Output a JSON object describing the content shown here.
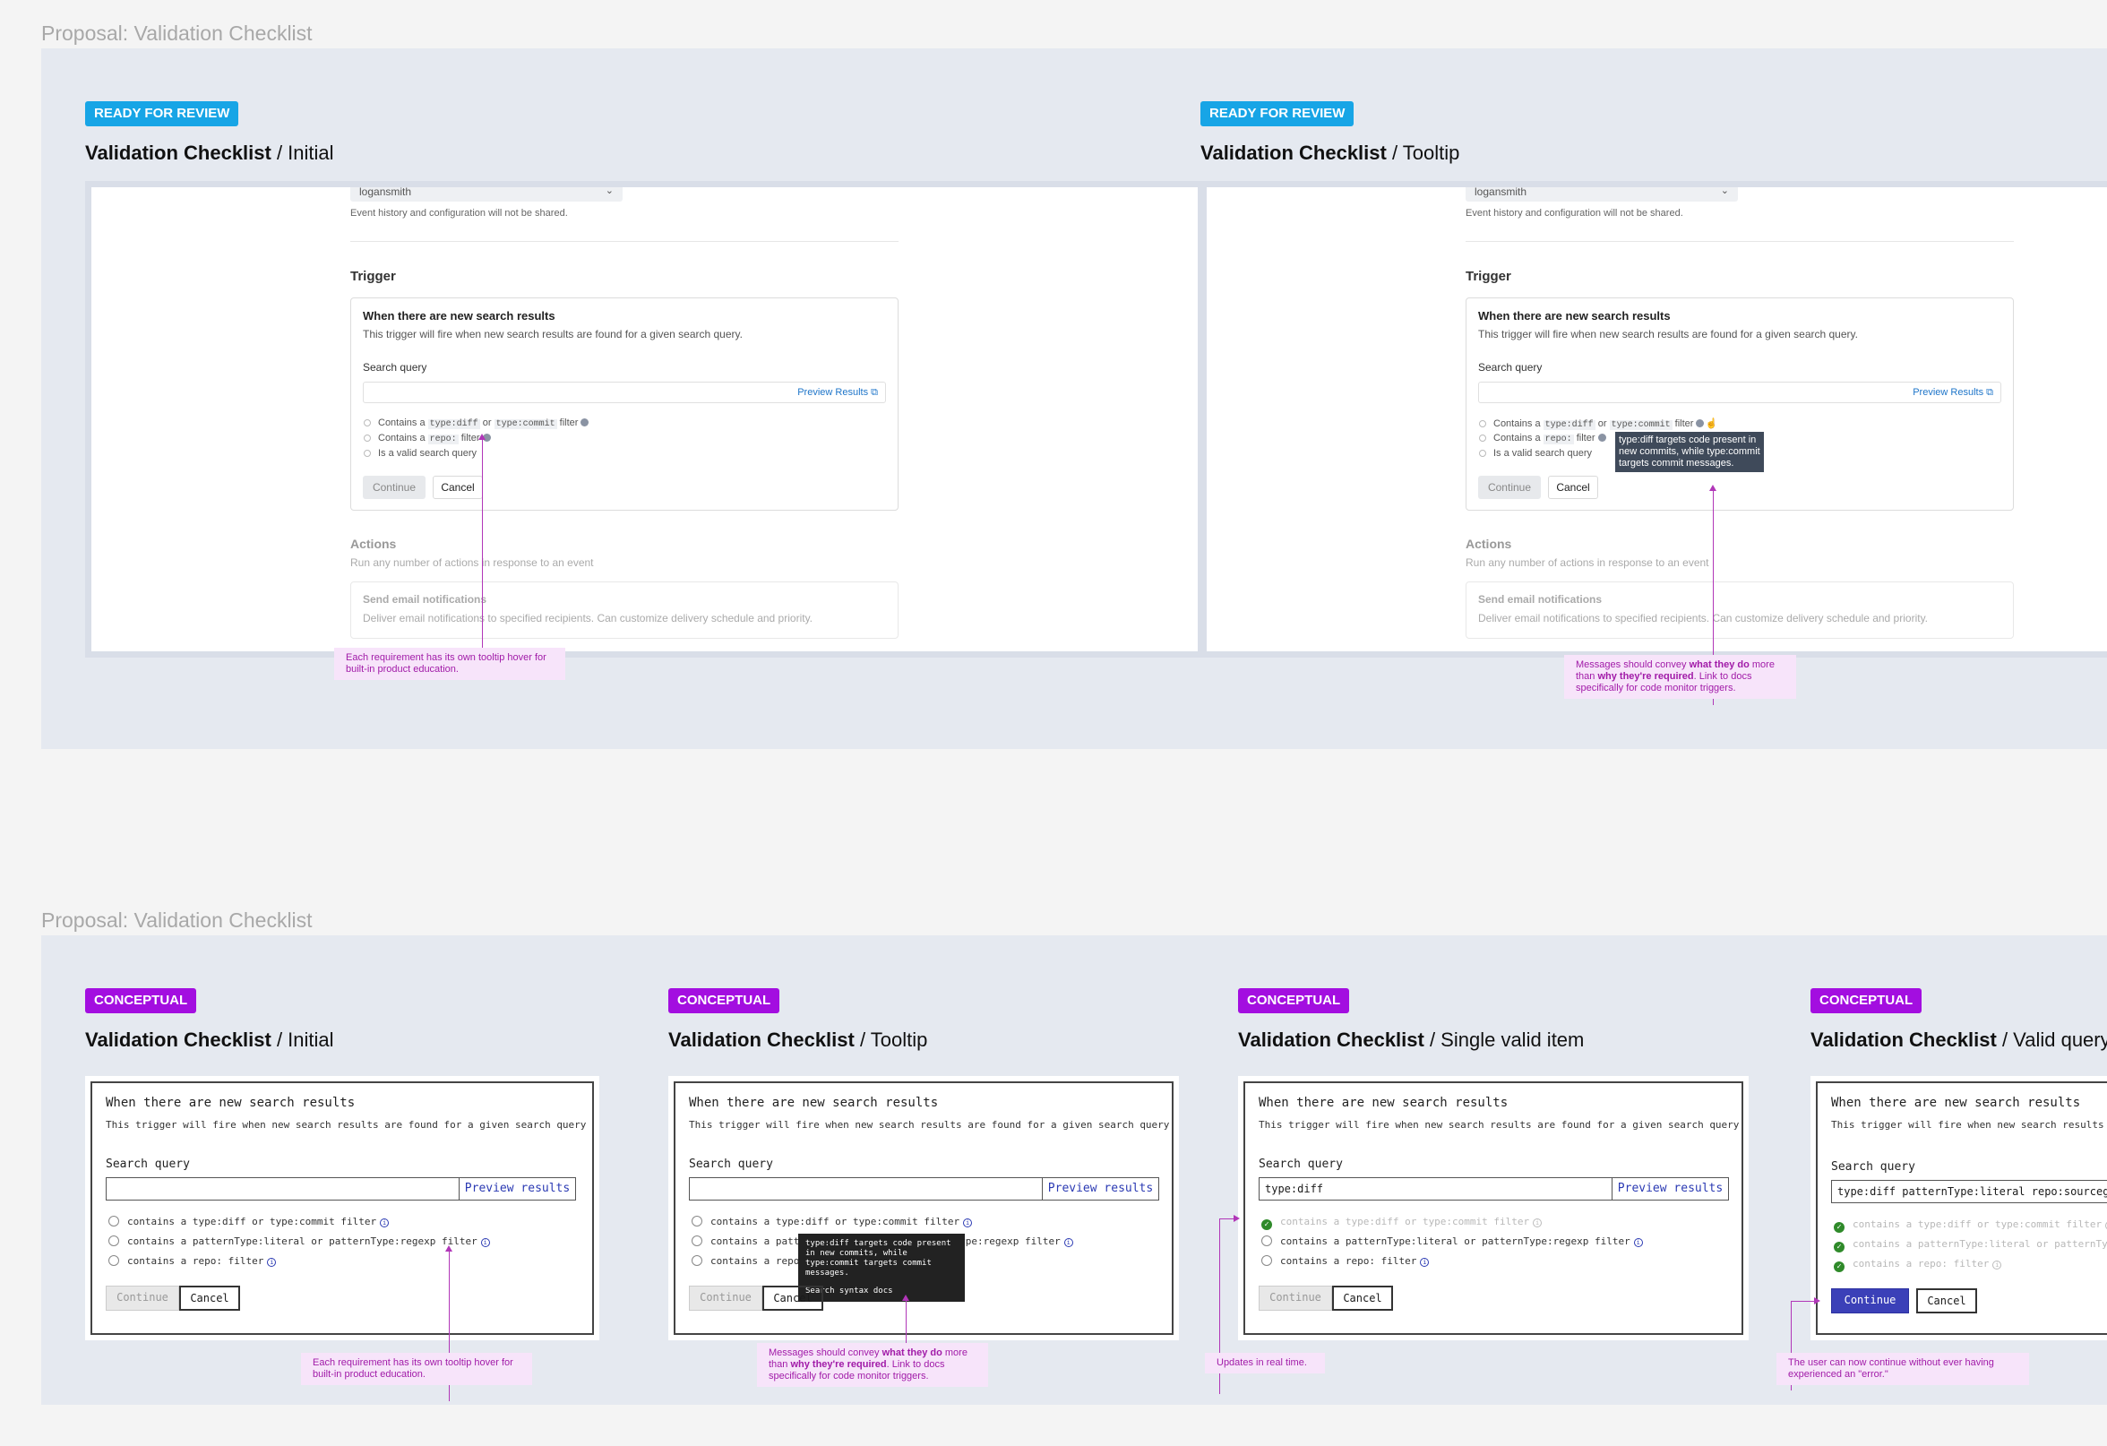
{
  "top": {
    "section_title": "Proposal: Validation Checklist",
    "frames": [
      {
        "badge": "READY FOR REVIEW",
        "title_bold": "Validation Checklist",
        "title_rest": " / Initial",
        "callout": "Each requirement has its own tooltip hover for built-in product education."
      },
      {
        "badge": "READY FOR REVIEW",
        "title_bold": "Validation Checklist",
        "title_rest": " / Tooltip",
        "tooltip": "type:diff targets code present in new commits, while type:commit targets commit messages.",
        "callout_pre": "Messages should convey ",
        "callout_b1": "what they do",
        "callout_mid": " more than ",
        "callout_b2": "why they're required",
        "callout_post": ". Link to docs specifically for code monitor triggers."
      }
    ],
    "mock": {
      "owner_value": "logansmith",
      "owner_note": "Event history and configuration will not be shared.",
      "trigger_heading": "Trigger",
      "card_title": "When there are new search results",
      "card_desc": "This trigger will fire when new search results are found for a given search query.",
      "search_label": "Search query",
      "preview_label": "Preview Results",
      "req1_pre": "Contains a ",
      "req1_code1": "type:diff",
      "req1_mid": " or ",
      "req1_code2": "type:commit",
      "req1_post": " filter",
      "req2_pre": "Contains a ",
      "req2_code": "repo:",
      "req2_post": " filter",
      "req3": "Is a valid search query",
      "continue_label": "Continue",
      "cancel_label": "Cancel",
      "actions_heading": "Actions",
      "actions_desc": "Run any number of actions in response to an event",
      "email_title": "Send email notifications",
      "email_desc": "Deliver email notifications to specified recipients. Can customize delivery schedule and priority."
    }
  },
  "bottom": {
    "section_title": "Proposal: Validation Checklist",
    "sketch": {
      "title": "When there are new search results",
      "desc": "This trigger will fire when new search results are found for a given search query",
      "search_label": "Search query",
      "preview_label": "Preview results",
      "req1": "contains a type:diff or type:commit filter",
      "req2": "contains a patternType:literal or patternType:regexp filter",
      "req3": "contains a repo: filter",
      "continue_label": "Continue",
      "cancel_label": "Cancel",
      "info_glyph": "i",
      "check_glyph": "✓"
    },
    "frames": [
      {
        "badge": "CONCEPTUAL",
        "title_bold": "Validation Checklist",
        "title_rest": " / Initial",
        "input_value": "",
        "callout": "Each requirement has its own tooltip hover for built-in product education."
      },
      {
        "badge": "CONCEPTUAL",
        "title_bold": "Validation Checklist",
        "title_rest": " / Tooltip",
        "input_value": "",
        "tooltip": "type:diff targets code present in new commits, while type:commit targets commit messages.",
        "tooltip_link": "Search syntax docs",
        "callout_pre": "Messages should convey ",
        "callout_b1": "what they do",
        "callout_mid": " more than ",
        "callout_b2": "why they're required",
        "callout_post": ". Link to docs specifically for code monitor triggers."
      },
      {
        "badge": "CONCEPTUAL",
        "title_bold": "Validation Checklist",
        "title_rest": " / Single valid item",
        "input_value": "type:diff",
        "callout": "Updates in real time."
      },
      {
        "badge": "CONCEPTUAL",
        "title_bold": "Validation Checklist",
        "title_rest": " / Valid query",
        "input_value": "type:diff patternType:literal repo:sourcegraph/sourcegraph",
        "callout": "The user can now continue without ever having experienced an \"error.\""
      }
    ]
  },
  "colors": {
    "ready_badge": "#17a5e6",
    "conceptual_badge": "#a30ee0",
    "annotation_bg": "#f7e4fa",
    "annotation_text": "#a11ba8",
    "board_bg": "#e5e9f0",
    "link_blue": "#1e75c9",
    "sketch_blue": "#2b3ab3",
    "valid_green": "#2f8a2a"
  }
}
